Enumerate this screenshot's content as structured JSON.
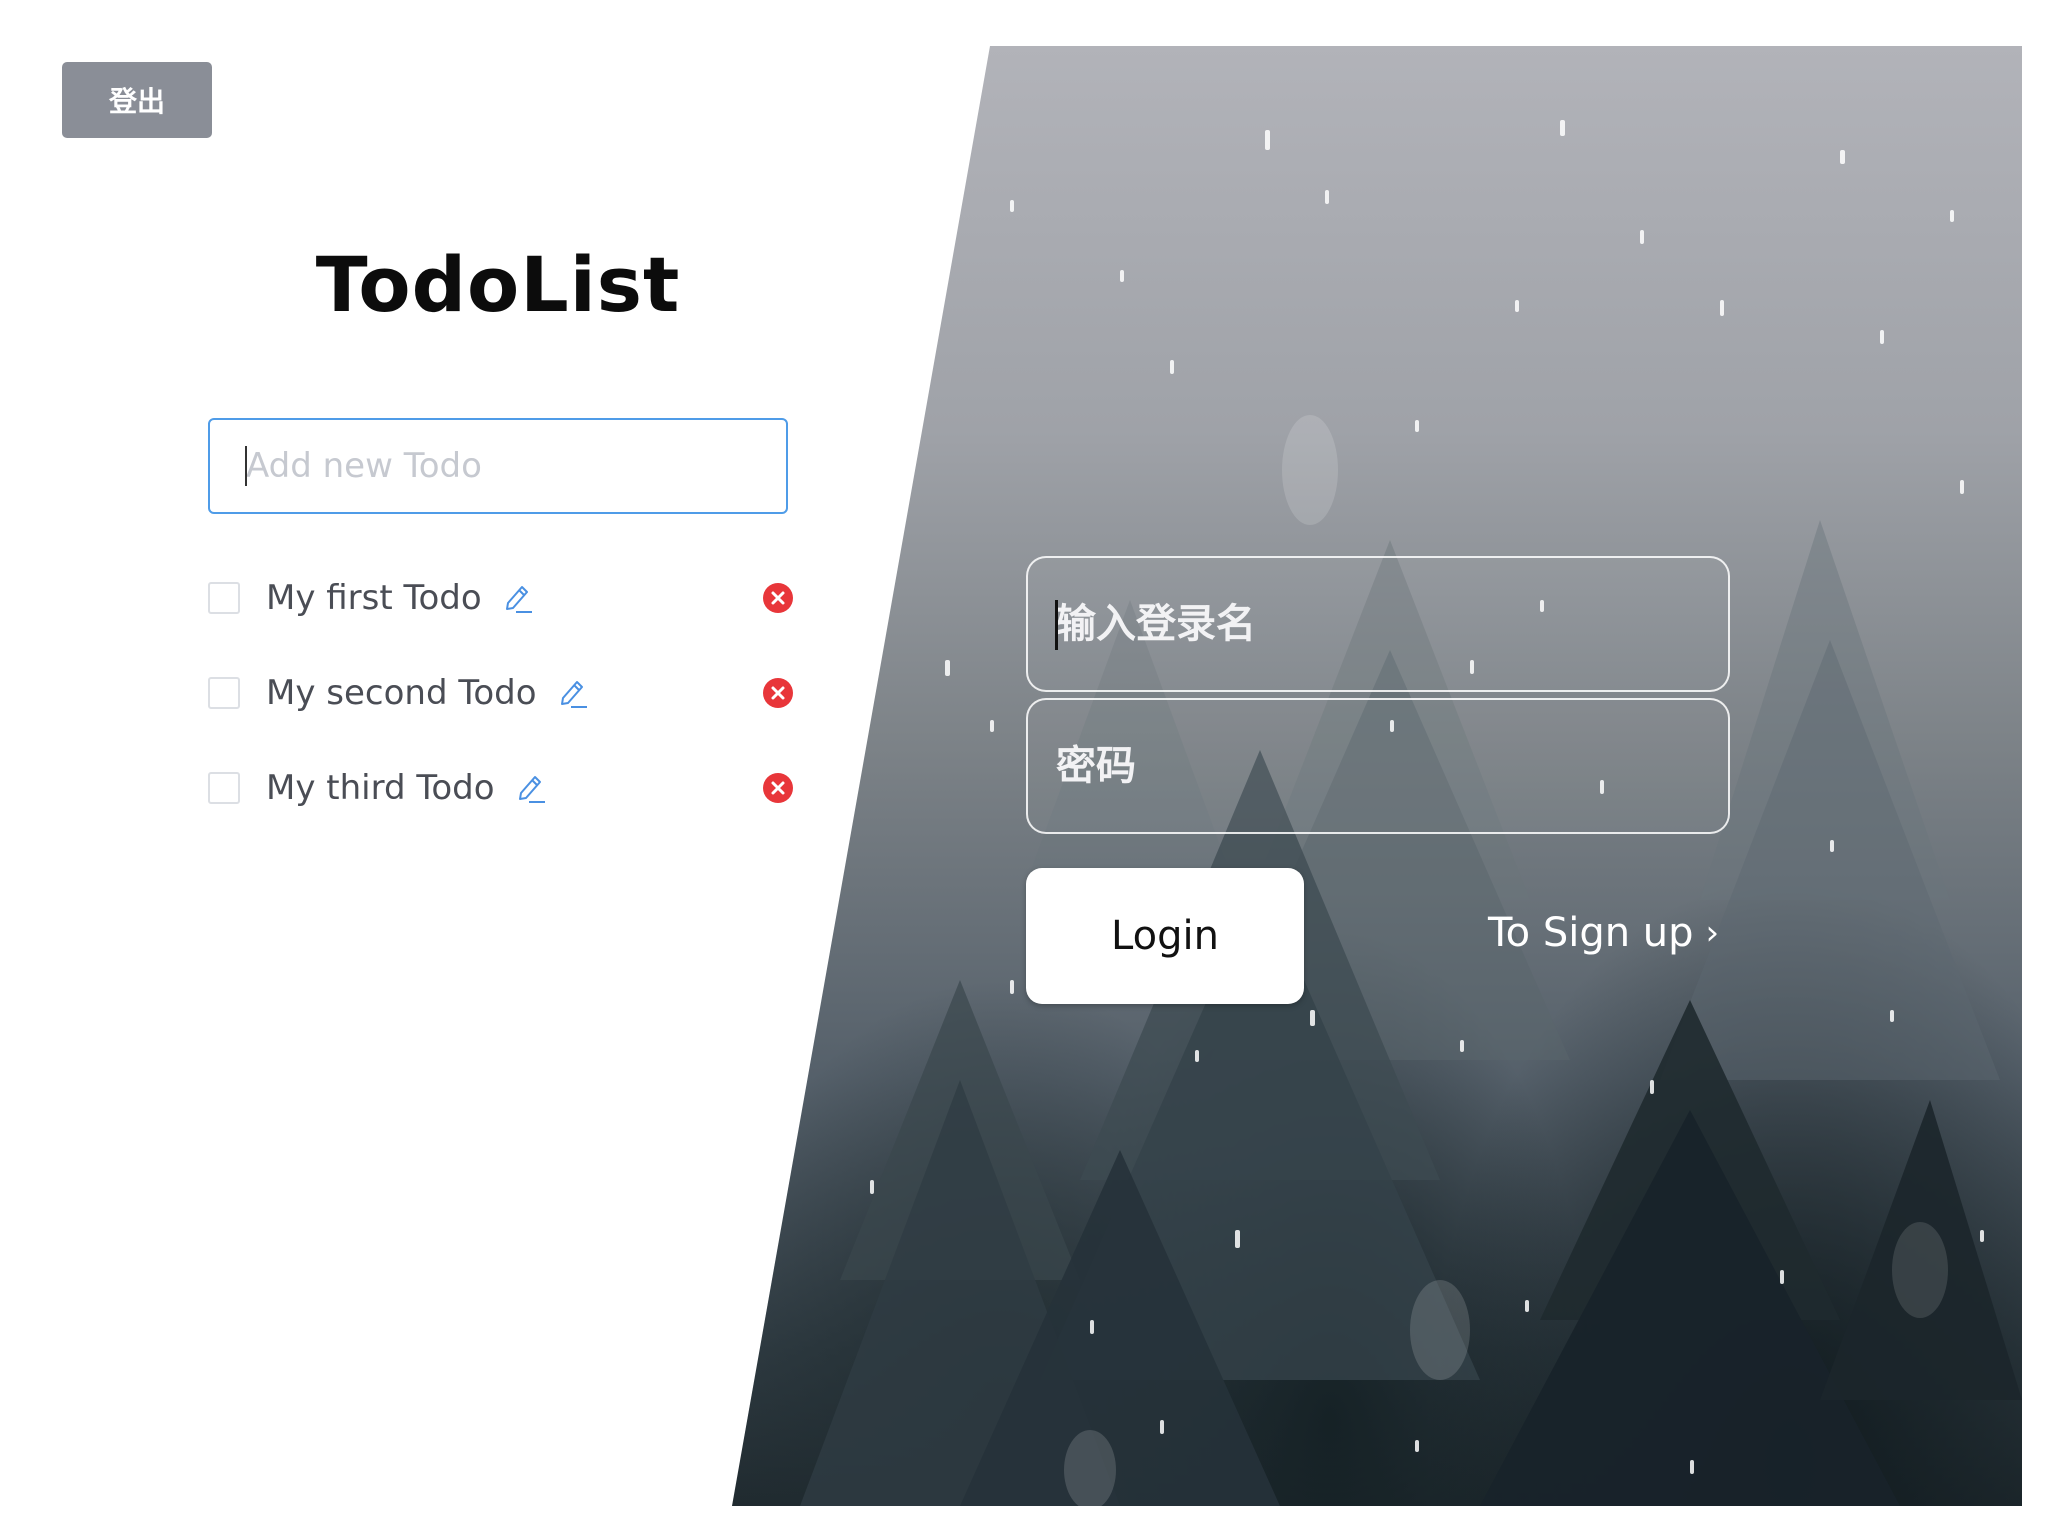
{
  "header": {
    "logout_label": "登出"
  },
  "todo": {
    "title": "TodoList",
    "input_placeholder": "Add new Todo",
    "items": [
      {
        "text": "My first Todo",
        "done": false
      },
      {
        "text": "My second Todo",
        "done": false
      },
      {
        "text": "My third Todo",
        "done": false
      }
    ],
    "icons": {
      "edit": "pencil-icon",
      "delete": "close-circle-icon"
    },
    "colors": {
      "input_border": "#4f9ce8",
      "delete": "#e8363a",
      "edit": "#4a90e2"
    }
  },
  "login": {
    "username_placeholder": "输入登录名",
    "password_placeholder": "密码",
    "login_label": "Login",
    "signup_label": "To Sign up",
    "signup_chevron": "›"
  }
}
